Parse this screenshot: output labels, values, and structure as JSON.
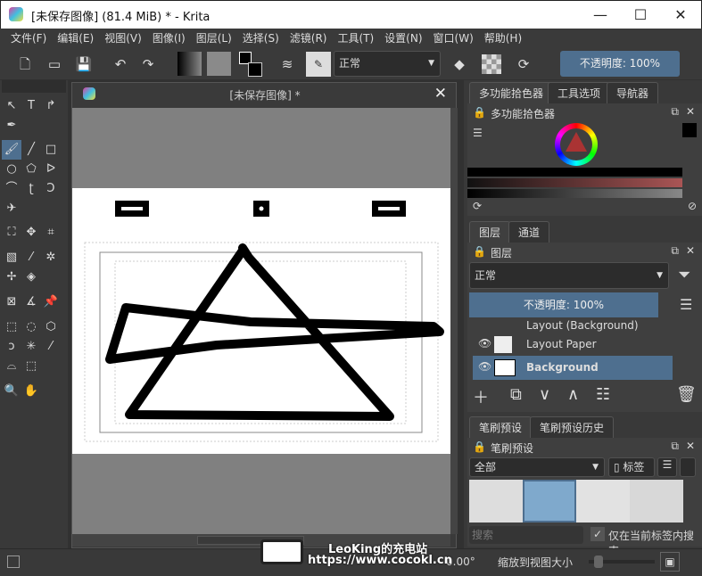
{
  "window": {
    "title": "[未保存图像]  (81.4 MiB)  * - Krita",
    "minimize": "—",
    "maximize": "☐",
    "close": "✕"
  },
  "menu": [
    "文件(F)",
    "编辑(E)",
    "视图(V)",
    "图像(I)",
    "图层(L)",
    "选择(S)",
    "滤镜(R)",
    "工具(T)",
    "设置(N)",
    "窗口(W)",
    "帮助(H)"
  ],
  "toolbar": {
    "blend_mode": "正常",
    "opacity": "不透明度: 100%"
  },
  "document": {
    "tab_title": "[未保存图像]  *",
    "close": "✕"
  },
  "dock": {
    "top_tabs": [
      "多功能拾色器",
      "工具选项",
      "导航器"
    ],
    "color_panel_title": "多功能拾色器",
    "layer_tabs": [
      "图层",
      "通道"
    ],
    "layers_title": "图层",
    "layer_blend": "正常",
    "layer_opacity": "不透明度:  100%",
    "layers": [
      {
        "name": "Layout (Background)",
        "selected": false
      },
      {
        "name": "Layout Paper",
        "selected": false
      },
      {
        "name": "Background",
        "selected": true
      }
    ],
    "brush_tabs": [
      "笔刷预设",
      "笔刷预设历史"
    ],
    "brush_title": "笔刷预设",
    "brush_filter": "全部",
    "tag_button": "标签",
    "search_placeholder": "搜索",
    "search_in_tag": "仅在当前标签内搜索",
    "search_in_tag_checked": true
  },
  "status": {
    "rotation": "0.00°",
    "zoom_label": "缩放到视图大小"
  },
  "watermark": {
    "line1": "LeoKing的充电站",
    "line2": "https://www.cocokl.cn"
  },
  "colors": {
    "accent": "#4e6f8f",
    "canvas_bg": "#808080"
  }
}
